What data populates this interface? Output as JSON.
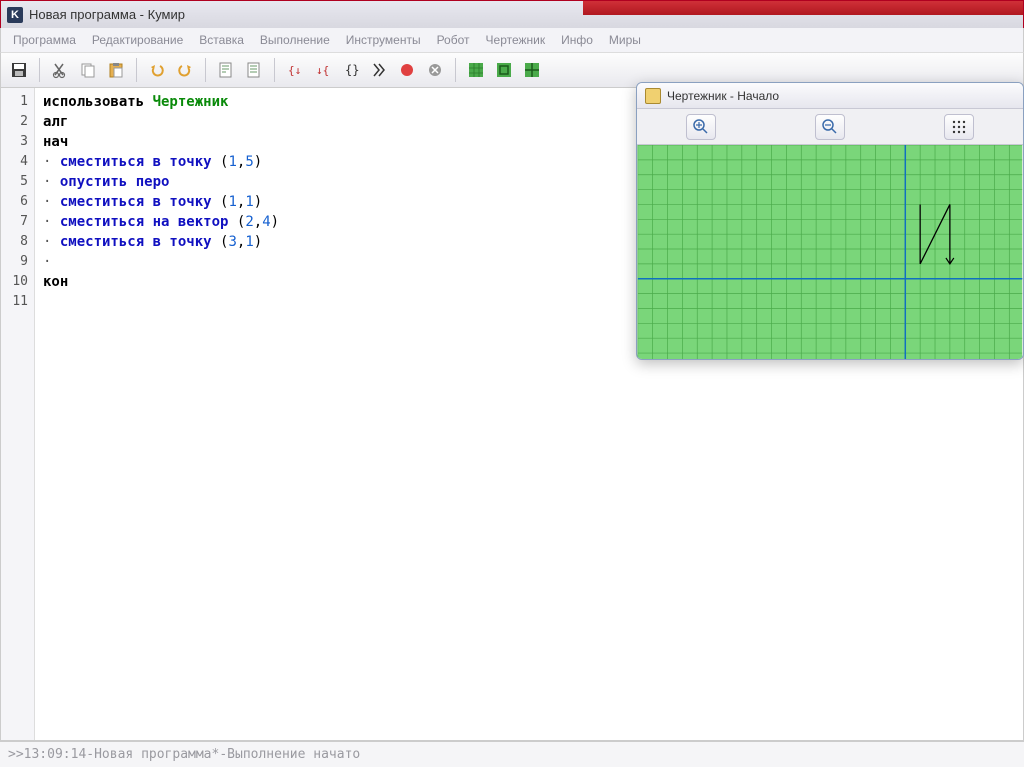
{
  "title": "Новая программа - Кумир",
  "menubar": [
    "Программа",
    "Редактирование",
    "Вставка",
    "Выполнение",
    "Инструменты",
    "Робот",
    "Чертежник",
    "Инфо",
    "Миры"
  ],
  "toolbar_icons": [
    "save-icon",
    "cut-icon",
    "copy-icon",
    "paste-icon",
    "undo-icon",
    "redo-icon",
    "doc1-icon",
    "doc2-icon",
    "step-in-icon",
    "step-over-icon",
    "braces-icon",
    "run-icon",
    "stop-icon",
    "cancel-icon",
    "grid1-icon",
    "grid2-icon",
    "grid3-icon"
  ],
  "code": {
    "lines": [
      {
        "n": 1,
        "tokens": [
          {
            "t": "использовать ",
            "c": "kwblack"
          },
          {
            "t": "Чертежник",
            "c": "ident"
          }
        ]
      },
      {
        "n": 2,
        "tokens": [
          {
            "t": "алг",
            "c": "kwblack"
          }
        ]
      },
      {
        "n": 3,
        "tokens": [
          {
            "t": "нач",
            "c": "kwblack"
          }
        ]
      },
      {
        "n": 4,
        "tokens": [
          {
            "t": "· ",
            "c": "bullet"
          },
          {
            "t": "сместиться в точку ",
            "c": "kw"
          },
          {
            "t": "(",
            "c": "paren"
          },
          {
            "t": "1",
            "c": "num"
          },
          {
            "t": ",",
            "c": "paren"
          },
          {
            "t": "5",
            "c": "num"
          },
          {
            "t": ")",
            "c": "paren"
          }
        ]
      },
      {
        "n": 5,
        "tokens": [
          {
            "t": "· ",
            "c": "bullet"
          },
          {
            "t": "опустить перо",
            "c": "kw"
          }
        ]
      },
      {
        "n": 6,
        "tokens": [
          {
            "t": "· ",
            "c": "bullet"
          },
          {
            "t": "сместиться в точку ",
            "c": "kw"
          },
          {
            "t": "(",
            "c": "paren"
          },
          {
            "t": "1",
            "c": "num"
          },
          {
            "t": ",",
            "c": "paren"
          },
          {
            "t": "1",
            "c": "num"
          },
          {
            "t": ")",
            "c": "paren"
          }
        ]
      },
      {
        "n": 7,
        "tokens": [
          {
            "t": "· ",
            "c": "bullet"
          },
          {
            "t": "сместиться на вектор ",
            "c": "kw"
          },
          {
            "t": "(",
            "c": "paren"
          },
          {
            "t": "2",
            "c": "num"
          },
          {
            "t": ",",
            "c": "paren"
          },
          {
            "t": "4",
            "c": "num"
          },
          {
            "t": ")",
            "c": "paren"
          }
        ]
      },
      {
        "n": 8,
        "tokens": [
          {
            "t": "· ",
            "c": "bullet"
          },
          {
            "t": "сместиться в точку ",
            "c": "kw"
          },
          {
            "t": "(",
            "c": "paren"
          },
          {
            "t": "3",
            "c": "num"
          },
          {
            "t": ",",
            "c": "paren"
          },
          {
            "t": "1",
            "c": "num"
          },
          {
            "t": ")",
            "c": "paren"
          }
        ]
      },
      {
        "n": 9,
        "tokens": [
          {
            "t": "·",
            "c": "bullet"
          }
        ]
      },
      {
        "n": 10,
        "tokens": [
          {
            "t": "кон",
            "c": "kwblack"
          }
        ]
      },
      {
        "n": 11,
        "tokens": []
      }
    ]
  },
  "status": {
    "prefix": ">> ",
    "time": "13:09:14",
    "sep": " - ",
    "name": "Новая программа*",
    "sep2": " - ",
    "msg": "Выполнение начато"
  },
  "float": {
    "title": "Чертежник - Начало",
    "tools": [
      "zoom-in-icon",
      "zoom-out-icon",
      "grid-dots-icon"
    ],
    "path": [
      [
        1,
        5
      ],
      [
        1,
        1
      ],
      [
        3,
        5
      ],
      [
        3,
        1
      ]
    ]
  }
}
